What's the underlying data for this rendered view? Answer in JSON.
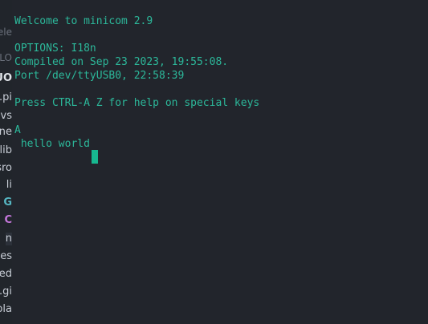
{
  "sidebar": {
    "items": [
      {
        "text": "ele"
      },
      {
        "text": "PLO"
      },
      {
        "text": "UO"
      },
      {
        "text": ".pi"
      },
      {
        "text": ".vs"
      },
      {
        "text": "ine"
      },
      {
        "text": "lib"
      },
      {
        "text": "sro"
      },
      {
        "text": "li"
      },
      {
        "text": "G"
      },
      {
        "text": "C"
      },
      {
        "text": "n"
      },
      {
        "text": "tes"
      },
      {
        "text": ".ed"
      },
      {
        "text": ".gi"
      },
      {
        "text": "pla"
      }
    ]
  },
  "terminal": {
    "lines": [
      "Welcome to minicom 2.9",
      "OPTIONS: I18n",
      "Compiled on Sep 23 2023, 19:55:08.",
      "Port /dev/ttyUSB0, 22:58:39",
      "Press CTRL-A Z for help on special keys",
      "A",
      " hello world"
    ],
    "text_color": "#2cb89a",
    "cursor_color": "#17b890"
  }
}
